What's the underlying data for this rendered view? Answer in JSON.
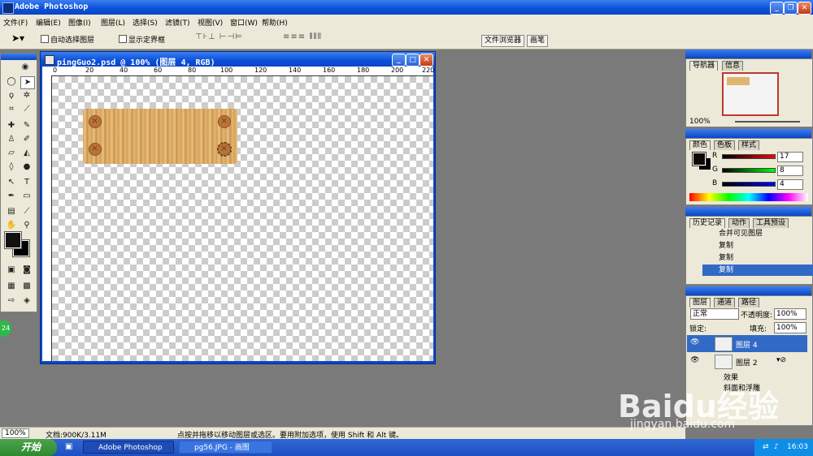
{
  "app": {
    "title": "Adobe Photoshop"
  },
  "menu": [
    "文件(F)",
    "编辑(E)",
    "图像(I)",
    "图层(L)",
    "选择(S)",
    "滤镜(T)",
    "视图(V)",
    "窗口(W)",
    "帮助(H)"
  ],
  "options": {
    "auto_select": "自动选择图层",
    "show_bounds": "显示定界框"
  },
  "palette_tabs": [
    "文件浏览器",
    "画笔"
  ],
  "document": {
    "title": "pingGuo2.psd @ 100% (图层 4, RGB)",
    "ruler_labels": [
      "0",
      "20",
      "40",
      "60",
      "80",
      "100",
      "120",
      "140",
      "160",
      "180",
      "200",
      "220"
    ]
  },
  "navigator": {
    "tabs": [
      "导航器",
      "信息"
    ],
    "zoom": "100%"
  },
  "color": {
    "tabs": [
      "颜色",
      "色板",
      "样式"
    ],
    "r_label": "R",
    "g_label": "G",
    "b_label": "B",
    "r": "17",
    "g": "8",
    "b": "4"
  },
  "history": {
    "tabs": [
      "历史记录",
      "动作",
      "工具预设"
    ],
    "items": [
      {
        "label": "合并可见图层",
        "active": false
      },
      {
        "label": "复制",
        "active": false
      },
      {
        "label": "复制",
        "active": false
      },
      {
        "label": "复制",
        "active": true
      }
    ]
  },
  "layers": {
    "tabs": [
      "图层",
      "通道",
      "路径"
    ],
    "blend": "正常",
    "opacity_label": "不透明度:",
    "opacity": "100%",
    "lock_label": "锁定:",
    "fill_label": "填充:",
    "fill": "100%",
    "items": [
      {
        "label": "图层 4",
        "active": true
      },
      {
        "label": "图层 2",
        "active": false
      }
    ],
    "effects_label": "效果",
    "effect": "斜面和浮雕"
  },
  "status": {
    "zoom": "100%",
    "doc": "文档:900K/3.11M",
    "hint": "点按并拖移以移动图层或选区。要用附加选项，使用 Shift 和 Alt 键。"
  },
  "taskbar": {
    "start": "开始",
    "tasks": [
      "Adobe Photoshop",
      "pg56.JPG - 画图"
    ],
    "clock": "16:03"
  },
  "badge": "24",
  "watermark": {
    "main": "Baidu经验",
    "sub": "jingyan.baidu.com"
  }
}
